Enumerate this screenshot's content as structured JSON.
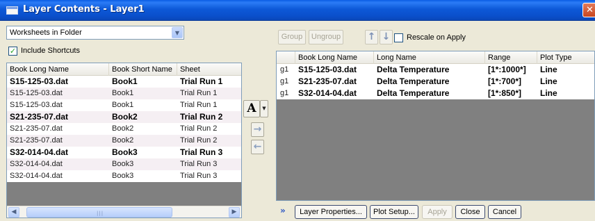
{
  "window": {
    "title": "Layer Contents - Layer1",
    "close_glyph": "✕"
  },
  "left": {
    "source_dropdown": {
      "value": "Worksheets in Folder",
      "arrow": "▼"
    },
    "include_shortcuts": {
      "label": "Include Shortcuts",
      "checked": true,
      "check_glyph": "✓"
    },
    "columns": [
      "Book Long Name",
      "Book Short Name",
      "Sheet"
    ],
    "rows": [
      {
        "long": "S15-125-03.dat",
        "short": "Book1",
        "sheet": "Trial Run 1",
        "bold": true
      },
      {
        "long": "S15-125-03.dat",
        "short": "Book1",
        "sheet": "Trial Run 1",
        "bold": false
      },
      {
        "long": "S15-125-03.dat",
        "short": "Book1",
        "sheet": "Trial Run 1",
        "bold": false
      },
      {
        "long": "S21-235-07.dat",
        "short": "Book2",
        "sheet": "Trial Run 2",
        "bold": true
      },
      {
        "long": "S21-235-07.dat",
        "short": "Book2",
        "sheet": "Trial Run 2",
        "bold": false
      },
      {
        "long": "S21-235-07.dat",
        "short": "Book2",
        "sheet": "Trial Run 2",
        "bold": false
      },
      {
        "long": "S32-014-04.dat",
        "short": "Book3",
        "sheet": "Trial Run 3",
        "bold": true
      },
      {
        "long": "S32-014-04.dat",
        "short": "Book3",
        "sheet": "Trial Run 3",
        "bold": false
      },
      {
        "long": "S32-014-04.dat",
        "short": "Book3",
        "sheet": "Trial Run 3",
        "bold": false
      }
    ],
    "scroll_left": "◀",
    "scroll_right": "▶",
    "scroll_grip": "|||"
  },
  "middle": {
    "font_button": "A",
    "font_dropdown": "▼",
    "add_arrow": "→",
    "remove_arrow": "←"
  },
  "right": {
    "toolbar": {
      "group": "Group",
      "ungroup": "Ungroup",
      "up_arrow": "↑",
      "down_arrow": "↓",
      "rescale_label": "Rescale on Apply",
      "rescale_checked": false
    },
    "columns": [
      "",
      "Book Long Name",
      "Long Name",
      "Range",
      "Plot Type"
    ],
    "rows": [
      {
        "layer": "g1",
        "book": "S15-125-03.dat",
        "long_name": "Delta Temperature",
        "range": "[1*:1000*]",
        "plot_type": "Line"
      },
      {
        "layer": "g1",
        "book": "S21-235-07.dat",
        "long_name": "Delta Temperature",
        "range": "[1*:700*]",
        "plot_type": "Line"
      },
      {
        "layer": "g1",
        "book": "S32-014-04.dat",
        "long_name": "Delta Temperature",
        "range": "[1*:850*]",
        "plot_type": "Line"
      }
    ]
  },
  "bottom": {
    "expand_glyph": "»",
    "layer_properties": "Layer Properties...",
    "plot_setup": "Plot Setup...",
    "apply": "Apply",
    "close": "Close",
    "cancel": "Cancel"
  },
  "colors": {
    "titlebar": "#0a5ce4",
    "dialog_bg": "#ece9d8",
    "empty_list_area": "#808080",
    "shaded_row": "#f5eff3"
  }
}
